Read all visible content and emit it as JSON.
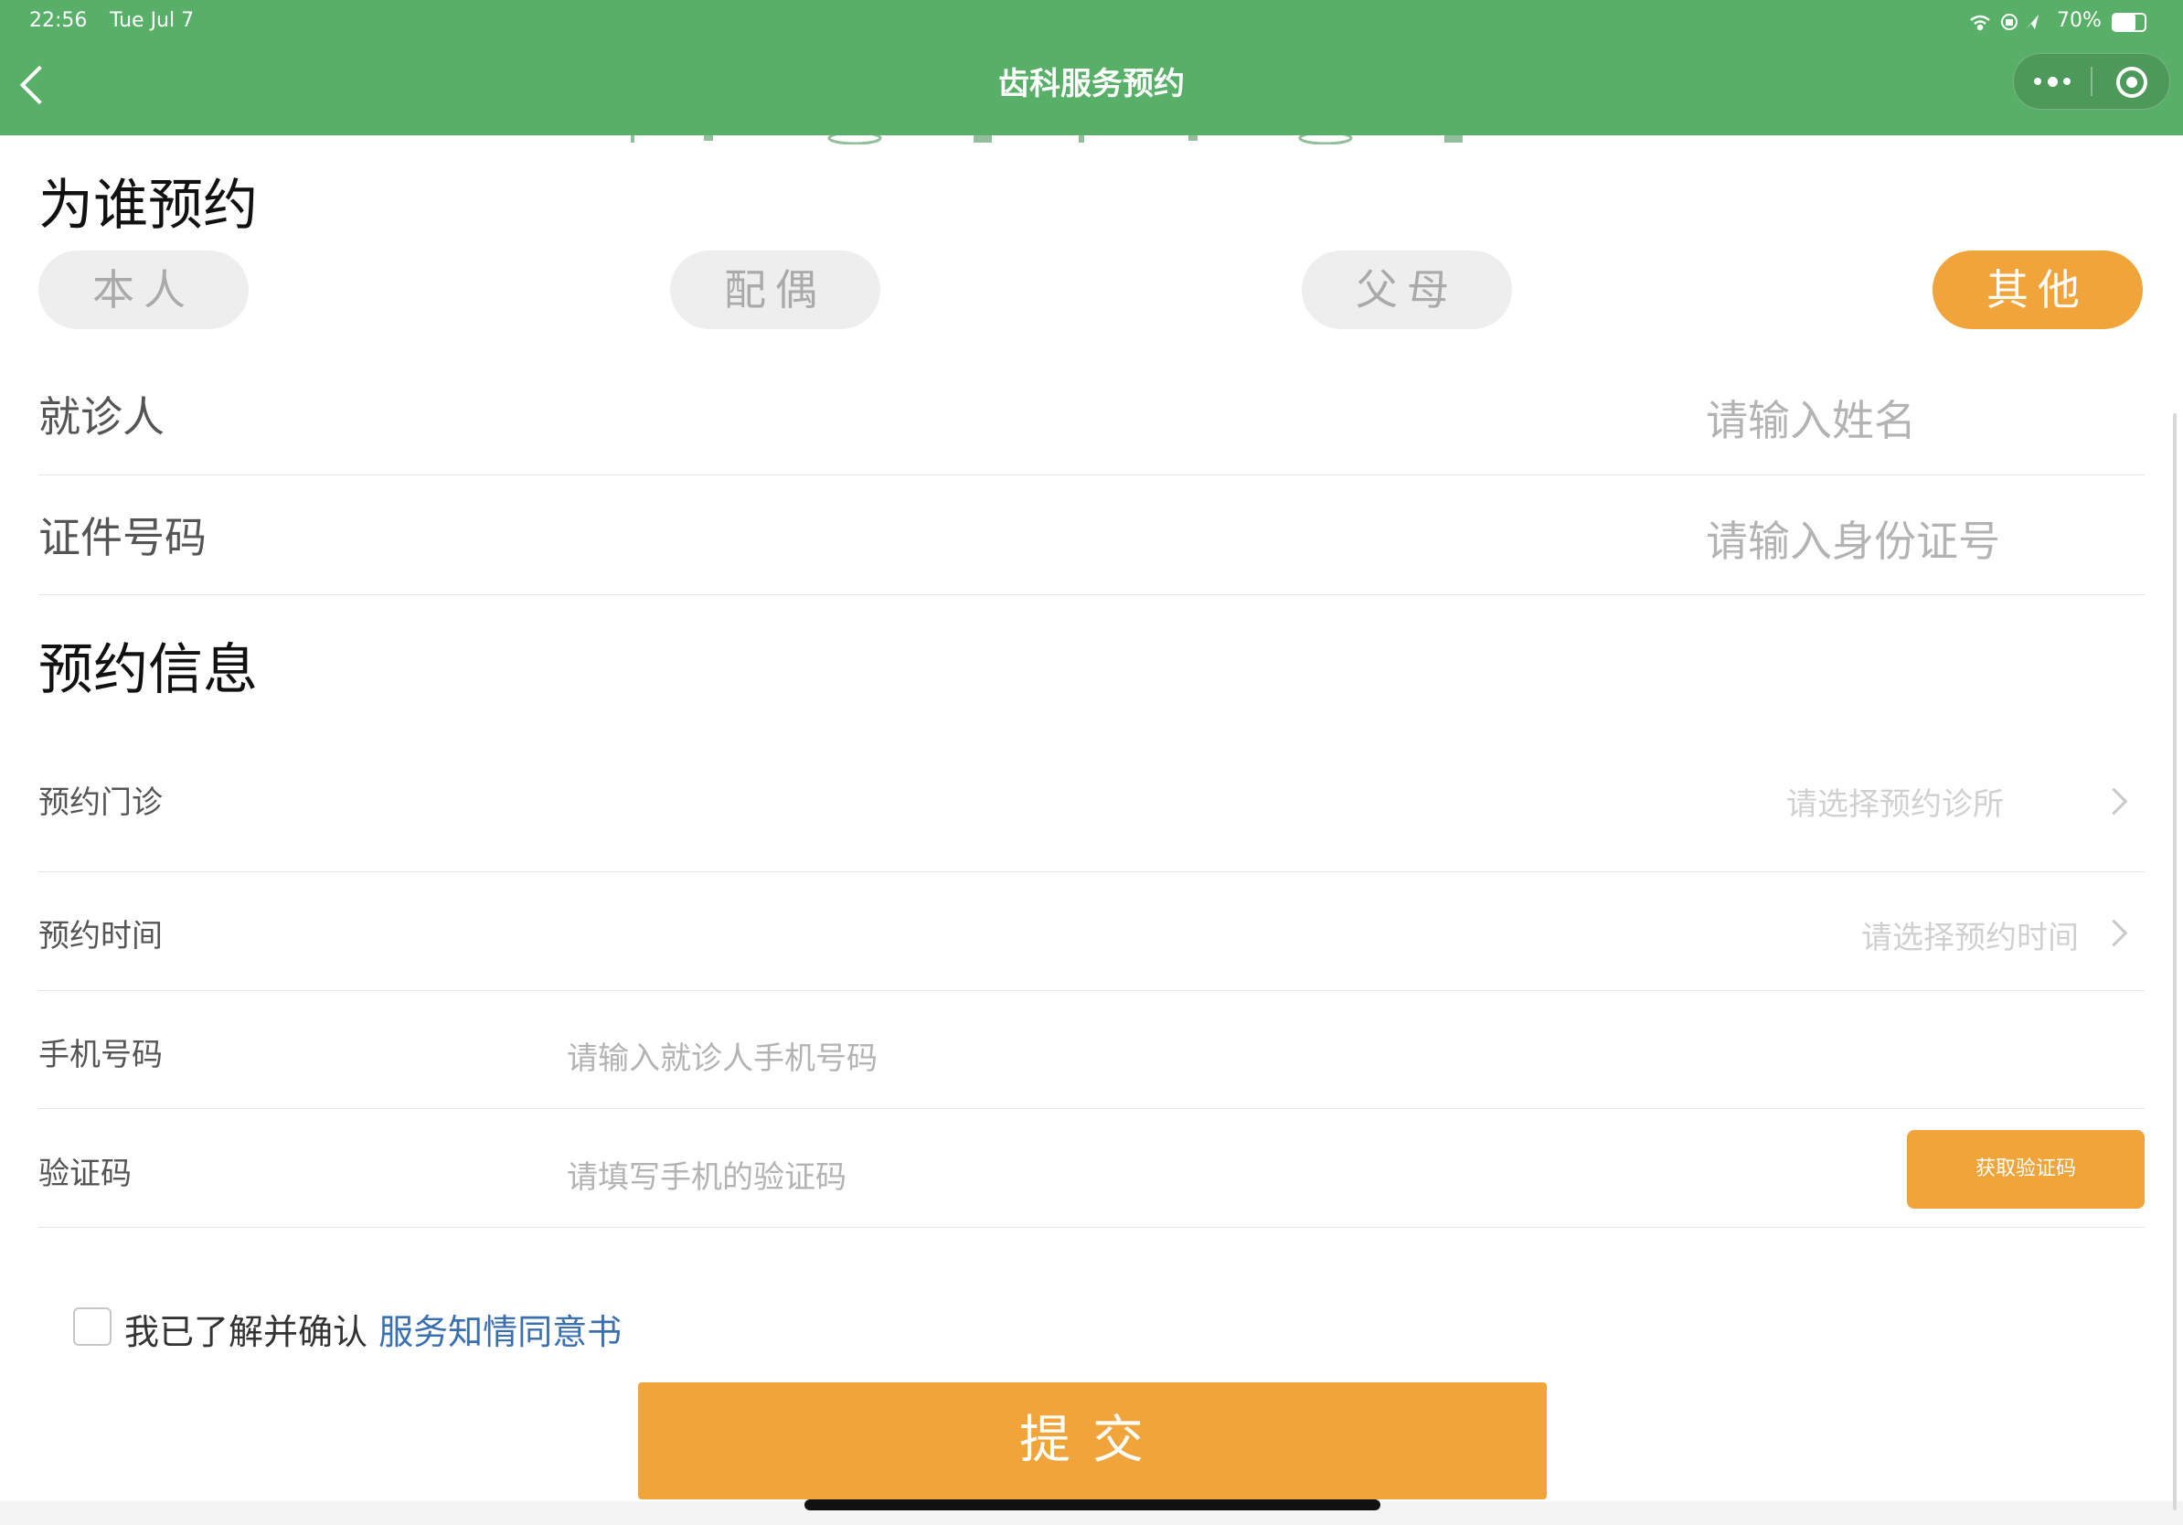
{
  "status_bar": {
    "time": "22:56",
    "date": "Tue Jul 7",
    "battery": "70%"
  },
  "nav": {
    "title": "齿科服务预约"
  },
  "who": {
    "title": "为谁预约",
    "options": [
      "本人",
      "配偶",
      "父母",
      "其他"
    ],
    "selected": "其他"
  },
  "patient": {
    "name_label": "就诊人",
    "name_placeholder": "请输入姓名",
    "id_label": "证件号码",
    "id_placeholder": "请输入身份证号"
  },
  "appointment": {
    "title": "预约信息",
    "clinic_label": "预约门诊",
    "clinic_placeholder": "请选择预约诊所",
    "time_label": "预约时间",
    "time_placeholder": "请选择预约时间",
    "phone_label": "手机号码",
    "phone_placeholder": "请输入就诊人手机号码",
    "code_label": "验证码",
    "code_placeholder": "请填写手机的验证码",
    "get_code_label": "获取验证码"
  },
  "consent": {
    "text": "我已了解并确认 ",
    "link": "服务知情同意书"
  },
  "submit_label": "提交",
  "colors": {
    "header_green": "#58b068",
    "accent_orange": "#f0a43a",
    "link_blue": "#3a6fb0"
  }
}
